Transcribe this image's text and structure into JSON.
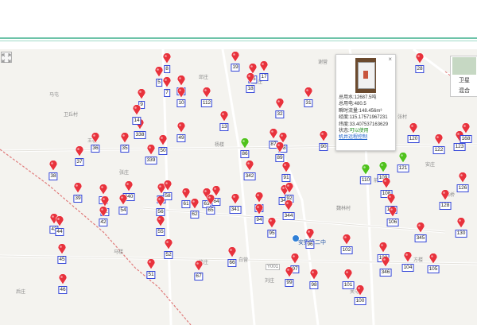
{
  "colors": {
    "red_pin": "#e8323c",
    "green_pin": "#4fc21c",
    "label_border": "#3446d8",
    "header_line": "#6cc3a8"
  },
  "map": {
    "place_names": {
      "ma_tun": "马屯",
      "wei_qiu_cun": "卫丘村",
      "xie_ying": "谢营",
      "an_zhuang": "安庄",
      "shi_qiao": "石桥",
      "wei_lin_cun": "魏林村",
      "ma_lou": "马楼",
      "xiu_zhuang": "修庄",
      "bai_ying": "白营",
      "liu_zhuang": "刘庄",
      "chang_zhuang": "常庄",
      "qian_yang": "前阳",
      "hou_zhuang": "后庄",
      "zhang_zhuang": "张庄",
      "yang_lou": "杨楼",
      "zhang_cun": "张村",
      "wang_lou": "王楼",
      "qiu_zhuang": "邱庄",
      "guan_tun": "关屯",
      "fang_lou": "方楼",
      "road_y001": "Y001",
      "school": "安集镇二中"
    },
    "markers": [
      {
        "label": "8",
        "color": "red"
      },
      {
        "label": "19",
        "color": "red"
      },
      {
        "label": "28",
        "color": "red"
      },
      {
        "label": "16",
        "color": "red"
      },
      {
        "label": "17",
        "color": "red"
      },
      {
        "label": "5",
        "color": "red"
      },
      {
        "label": "7",
        "color": "red"
      },
      {
        "label": "15",
        "color": "red"
      },
      {
        "label": "18",
        "color": "red"
      },
      {
        "label": "10",
        "color": "red"
      },
      {
        "label": "112",
        "color": "red"
      },
      {
        "label": "9",
        "color": "red"
      },
      {
        "label": "31",
        "color": "red"
      },
      {
        "label": "32",
        "color": "red"
      },
      {
        "label": "13",
        "color": "red"
      },
      {
        "label": "338",
        "color": "red"
      },
      {
        "label": "14",
        "color": "red"
      },
      {
        "label": "35",
        "color": "red"
      },
      {
        "label": "36",
        "color": "red"
      },
      {
        "label": "37",
        "color": "red"
      },
      {
        "label": "38",
        "color": "red"
      },
      {
        "label": "339",
        "color": "red"
      },
      {
        "label": "50",
        "color": "red"
      },
      {
        "label": "49",
        "color": "red"
      },
      {
        "label": "87",
        "color": "red"
      },
      {
        "label": "88",
        "color": "red"
      },
      {
        "label": "89",
        "color": "red"
      },
      {
        "label": "86",
        "color": "green"
      },
      {
        "label": "90",
        "color": "red"
      },
      {
        "label": "342",
        "color": "red"
      },
      {
        "label": "91",
        "color": "red"
      },
      {
        "label": "120",
        "color": "red"
      },
      {
        "label": "122",
        "color": "red"
      },
      {
        "label": "123",
        "color": "red"
      },
      {
        "label": "168",
        "color": "red"
      },
      {
        "label": "121",
        "color": "green"
      },
      {
        "label": "110",
        "color": "green"
      },
      {
        "label": "109",
        "color": "green"
      },
      {
        "label": "108",
        "color": "red"
      },
      {
        "label": "107",
        "color": "red"
      },
      {
        "label": "106",
        "color": "red"
      },
      {
        "label": "126",
        "color": "red"
      },
      {
        "label": "128",
        "color": "red"
      },
      {
        "label": "39",
        "color": "red"
      },
      {
        "label": "40",
        "color": "red"
      },
      {
        "label": "41",
        "color": "red"
      },
      {
        "label": "42",
        "color": "red"
      },
      {
        "label": "340",
        "color": "red"
      },
      {
        "label": "57",
        "color": "red"
      },
      {
        "label": "58",
        "color": "red"
      },
      {
        "label": "61",
        "color": "red"
      },
      {
        "label": "62",
        "color": "red"
      },
      {
        "label": "63",
        "color": "red"
      },
      {
        "label": "64",
        "color": "red"
      },
      {
        "label": "65",
        "color": "red"
      },
      {
        "label": "341",
        "color": "red"
      },
      {
        "label": "93",
        "color": "red"
      },
      {
        "label": "94",
        "color": "red"
      },
      {
        "label": "343",
        "color": "red"
      },
      {
        "label": "92",
        "color": "red"
      },
      {
        "label": "344",
        "color": "red"
      },
      {
        "label": "54",
        "color": "red"
      },
      {
        "label": "56",
        "color": "red"
      },
      {
        "label": "55",
        "color": "red"
      },
      {
        "label": "43",
        "color": "red"
      },
      {
        "label": "44",
        "color": "red"
      },
      {
        "label": "95",
        "color": "red"
      },
      {
        "label": "96",
        "color": "red"
      },
      {
        "label": "130",
        "color": "red"
      },
      {
        "label": "345",
        "color": "red"
      },
      {
        "label": "45",
        "color": "red"
      },
      {
        "label": "52",
        "color": "red"
      },
      {
        "label": "66",
        "color": "red"
      },
      {
        "label": "102",
        "color": "red"
      },
      {
        "label": "103",
        "color": "red"
      },
      {
        "label": "346",
        "color": "red"
      },
      {
        "label": "104",
        "color": "red"
      },
      {
        "label": "105",
        "color": "red"
      },
      {
        "label": "51",
        "color": "red"
      },
      {
        "label": "97",
        "color": "red"
      },
      {
        "label": "67",
        "color": "red"
      },
      {
        "label": "98",
        "color": "red"
      },
      {
        "label": "99",
        "color": "red"
      },
      {
        "label": "101",
        "color": "red"
      },
      {
        "label": "46",
        "color": "red"
      },
      {
        "label": "100",
        "color": "red"
      }
    ]
  },
  "popup": {
    "close_glyph": "×",
    "total_water": "总用水:12687.5吨",
    "total_power": "总用电:480.5",
    "instant_flow": "瞬时流量:148.456m³",
    "longitude": "经度:115.17571967231",
    "latitude": "纬度:33.407537163629",
    "status_prefix": "状态:",
    "status_value": "可以使用",
    "link": "机井远程控制"
  },
  "map_type": {
    "satellite": "卫星",
    "hybrid": "混合"
  }
}
